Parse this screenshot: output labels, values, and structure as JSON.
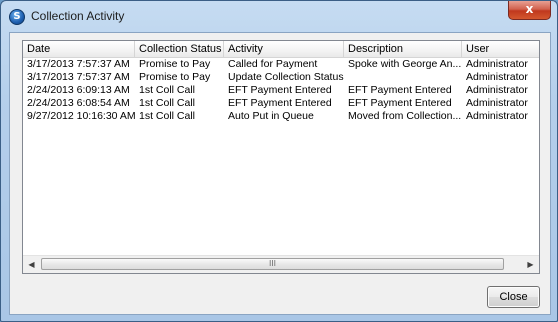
{
  "window": {
    "title": "Collection Activity",
    "app_icon_letter": "S",
    "close_glyph": "x"
  },
  "table": {
    "columns": [
      {
        "label": "Date"
      },
      {
        "label": "Collection Status"
      },
      {
        "label": "Activity"
      },
      {
        "label": "Description"
      },
      {
        "label": "User"
      }
    ],
    "rows": [
      [
        "3/17/2013 7:57:37 AM",
        "Promise to Pay",
        "Called for Payment",
        "Spoke with George An...",
        "Administrator"
      ],
      [
        "3/17/2013 7:57:37 AM",
        "Promise to Pay",
        "Update Collection Status",
        "",
        "Administrator"
      ],
      [
        "2/24/2013 6:09:13 AM",
        "1st Coll Call",
        "EFT Payment Entered",
        "EFT Payment Entered",
        "Administrator"
      ],
      [
        "2/24/2013 6:08:54 AM",
        "1st Coll Call",
        "EFT Payment Entered",
        "EFT Payment Entered",
        "Administrator"
      ],
      [
        "9/27/2012 10:16:30 AM",
        "1st Coll Call",
        "Auto Put in Queue",
        "Moved from Collection...",
        "Administrator"
      ]
    ]
  },
  "scrollbar": {
    "left_arrow": "◀",
    "right_arrow": "▶",
    "grip": "III"
  },
  "buttons": {
    "close_label": "Close"
  }
}
